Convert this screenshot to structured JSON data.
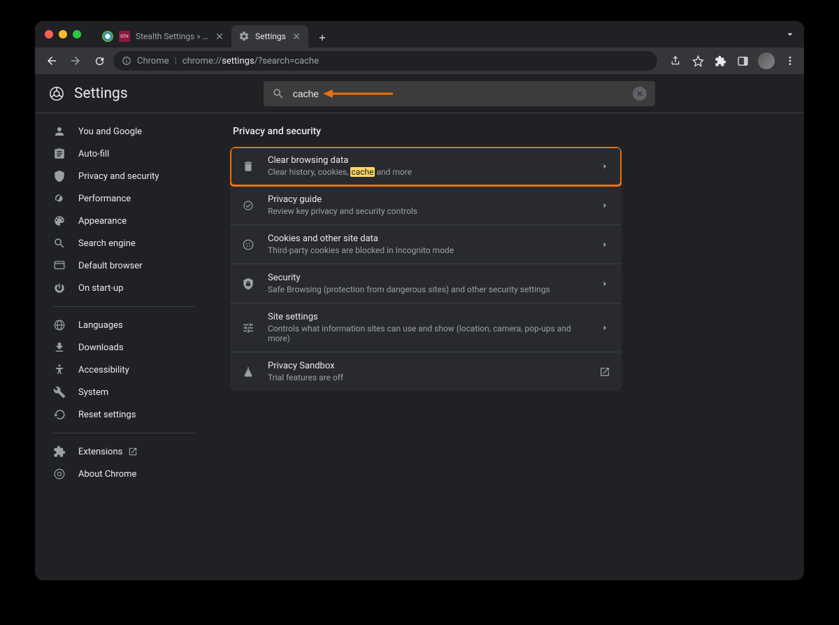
{
  "tabs": [
    {
      "title": "Stealth Settings » Sursa de tut"
    },
    {
      "title": "Settings"
    }
  ],
  "url": {
    "chrome_label": "Chrome",
    "scheme": "chrome://",
    "host": "settings",
    "path": "/?search=cache"
  },
  "app_title": "Settings",
  "search_value": "cache",
  "section_title": "Privacy and security",
  "sidebar": {
    "group1": [
      {
        "label": "You and Google"
      },
      {
        "label": "Auto-fill"
      },
      {
        "label": "Privacy and security"
      },
      {
        "label": "Performance"
      },
      {
        "label": "Appearance"
      },
      {
        "label": "Search engine"
      },
      {
        "label": "Default browser"
      },
      {
        "label": "On start-up"
      }
    ],
    "group2": [
      {
        "label": "Languages"
      },
      {
        "label": "Downloads"
      },
      {
        "label": "Accessibility"
      },
      {
        "label": "System"
      },
      {
        "label": "Reset settings"
      }
    ],
    "group3": [
      {
        "label": "Extensions"
      },
      {
        "label": "About Chrome"
      }
    ]
  },
  "rows": [
    {
      "title": "Clear browsing data",
      "sub_pre": "Clear history, cookies, ",
      "sub_hl": "cache",
      "sub_post": " and more"
    },
    {
      "title": "Privacy guide",
      "sub": "Review key privacy and security controls"
    },
    {
      "title": "Cookies and other site data",
      "sub": "Third-party cookies are blocked in Incognito mode"
    },
    {
      "title": "Security",
      "sub": "Safe Browsing (protection from dangerous sites) and other security settings"
    },
    {
      "title": "Site settings",
      "sub": "Controls what information sites can use and show (location, camera, pop-ups and more)"
    },
    {
      "title": "Privacy Sandbox",
      "sub": "Trial features are off"
    }
  ]
}
